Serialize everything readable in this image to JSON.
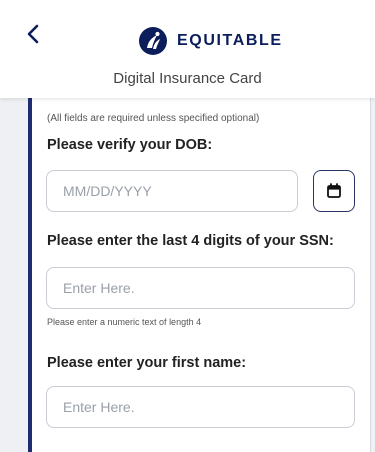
{
  "header": {
    "brand_name": "EQUITABLE",
    "subtitle": "Digital Insurance Card",
    "back_icon": "chevron-left-icon",
    "logo_icon": "equitable-logo-icon"
  },
  "form": {
    "note": "(All fields are required unless specified optional)",
    "dob": {
      "label": "Please verify your DOB:",
      "placeholder": "MM/DD/YYYY",
      "calendar_icon": "calendar-icon"
    },
    "ssn": {
      "label": "Please enter the last 4 digits of your SSN:",
      "placeholder": "Enter Here.",
      "helper": "Please enter a numeric text of length 4"
    },
    "first_name": {
      "label": "Please enter your first name:",
      "placeholder": "Enter Here."
    }
  },
  "colors": {
    "brand_navy": "#0b1e5b",
    "card_accent": "#1f2c6f",
    "page_background": "#eef0f3"
  }
}
